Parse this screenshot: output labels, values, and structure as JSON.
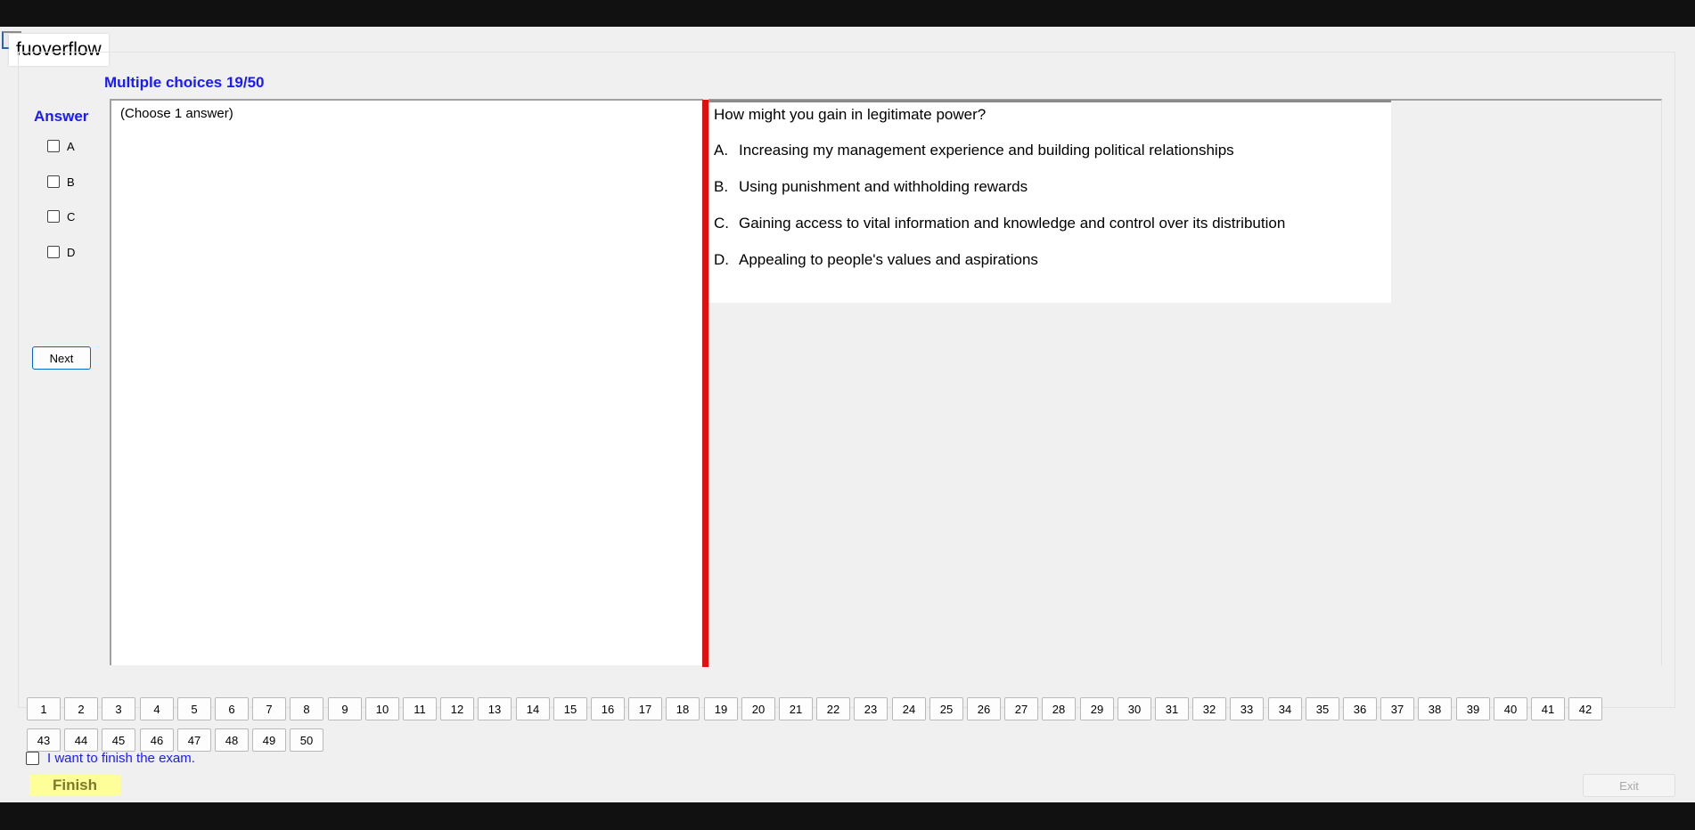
{
  "app": {
    "brand": "fuoverflow",
    "counter": "Multiple choices 19/50"
  },
  "answer_panel": {
    "title": "Answer",
    "options": [
      "A",
      "B",
      "C",
      "D"
    ],
    "next_label": "Next"
  },
  "instruction": "(Choose 1 answer)",
  "question": {
    "text": "How might you gain in legitimate power?",
    "choices": [
      {
        "letter": "A.",
        "text": "Increasing my management experience and building political relationships"
      },
      {
        "letter": "B.",
        "text": "Using punishment and withholding rewards"
      },
      {
        "letter": "C.",
        "text": "Gaining access to vital information and knowledge and control over its distribution"
      },
      {
        "letter": "D.",
        "text": "Appealing to people's values and aspirations"
      }
    ]
  },
  "question_nav": [
    "1",
    "2",
    "3",
    "4",
    "5",
    "6",
    "7",
    "8",
    "9",
    "10",
    "11",
    "12",
    "13",
    "14",
    "15",
    "16",
    "17",
    "18",
    "19",
    "20",
    "21",
    "22",
    "23",
    "24",
    "25",
    "26",
    "27",
    "28",
    "29",
    "30",
    "31",
    "32",
    "33",
    "34",
    "35",
    "36",
    "37",
    "38",
    "39",
    "40",
    "41",
    "42",
    "43",
    "44",
    "45",
    "46",
    "47",
    "48",
    "49",
    "50"
  ],
  "footer": {
    "finish_checkbox_label": "I want to finish the exam.",
    "finish_label": "Finish",
    "exit_label": "Exit"
  },
  "colors": {
    "accent_blue": "#1a1aff",
    "splitter_red": "#e01010",
    "finish_yellow": "#ffff99"
  }
}
